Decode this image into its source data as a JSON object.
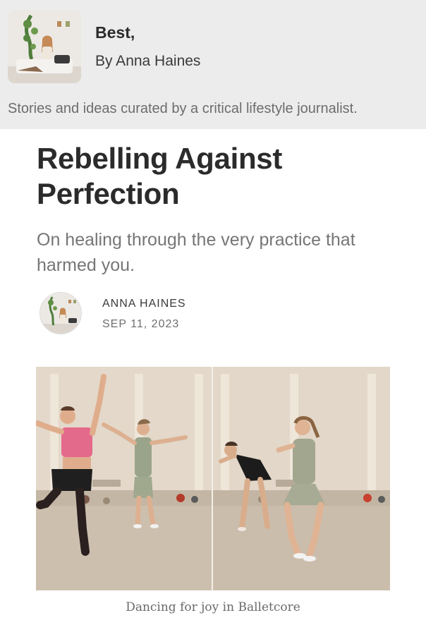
{
  "publication": {
    "name": "Best,",
    "byline": "By Anna Haines",
    "tagline": "Stories and ideas curated by a critical lifestyle journalist."
  },
  "article": {
    "title": "Rebelling Against Perfection",
    "subtitle": "On healing through the very practice that harmed you.",
    "author": "ANNA HAINES",
    "date": "SEP 11, 2023",
    "image_caption": "Dancing for joy in Balletcore"
  },
  "colors": {
    "header_bg": "#ececec",
    "title_text": "#2b2b2b",
    "muted_text": "#767676"
  }
}
